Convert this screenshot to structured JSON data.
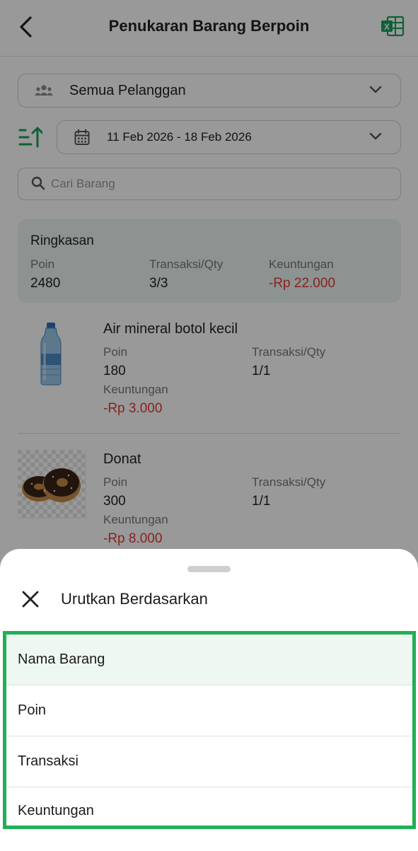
{
  "header": {
    "title": "Penukaran Barang Berpoin",
    "accent": "#1a9e5c"
  },
  "filters": {
    "customer": "Semua Pelanggan",
    "date_range": "11 Feb 2026 - 18 Feb 2026",
    "search_placeholder": "Cari Barang"
  },
  "summary": {
    "title": "Ringkasan",
    "poin_label": "Poin",
    "poin_value": "2480",
    "trx_label": "Transaksi/Qty",
    "trx_value": "3/3",
    "profit_label": "Keuntungan",
    "profit_value": "-Rp 22.000"
  },
  "items": [
    {
      "name": "Air mineral botol kecil",
      "poin_label": "Poin",
      "poin": "180",
      "trx_label": "Transaksi/Qty",
      "trx": "1/1",
      "profit_label": "Keuntungan",
      "profit": "-Rp 3.000"
    },
    {
      "name": "Donat",
      "poin_label": "Poin",
      "poin": "300",
      "trx_label": "Transaksi/Qty",
      "trx": "1/1",
      "profit_label": "Keuntungan",
      "profit": "-Rp 8.000"
    }
  ],
  "sort_sheet": {
    "title": "Urutkan Berdasarkan",
    "options": [
      "Nama Barang",
      "Poin",
      "Transaksi",
      "Keuntungan"
    ],
    "selected": "Nama Barang",
    "highlight_color": "#1fb055"
  }
}
